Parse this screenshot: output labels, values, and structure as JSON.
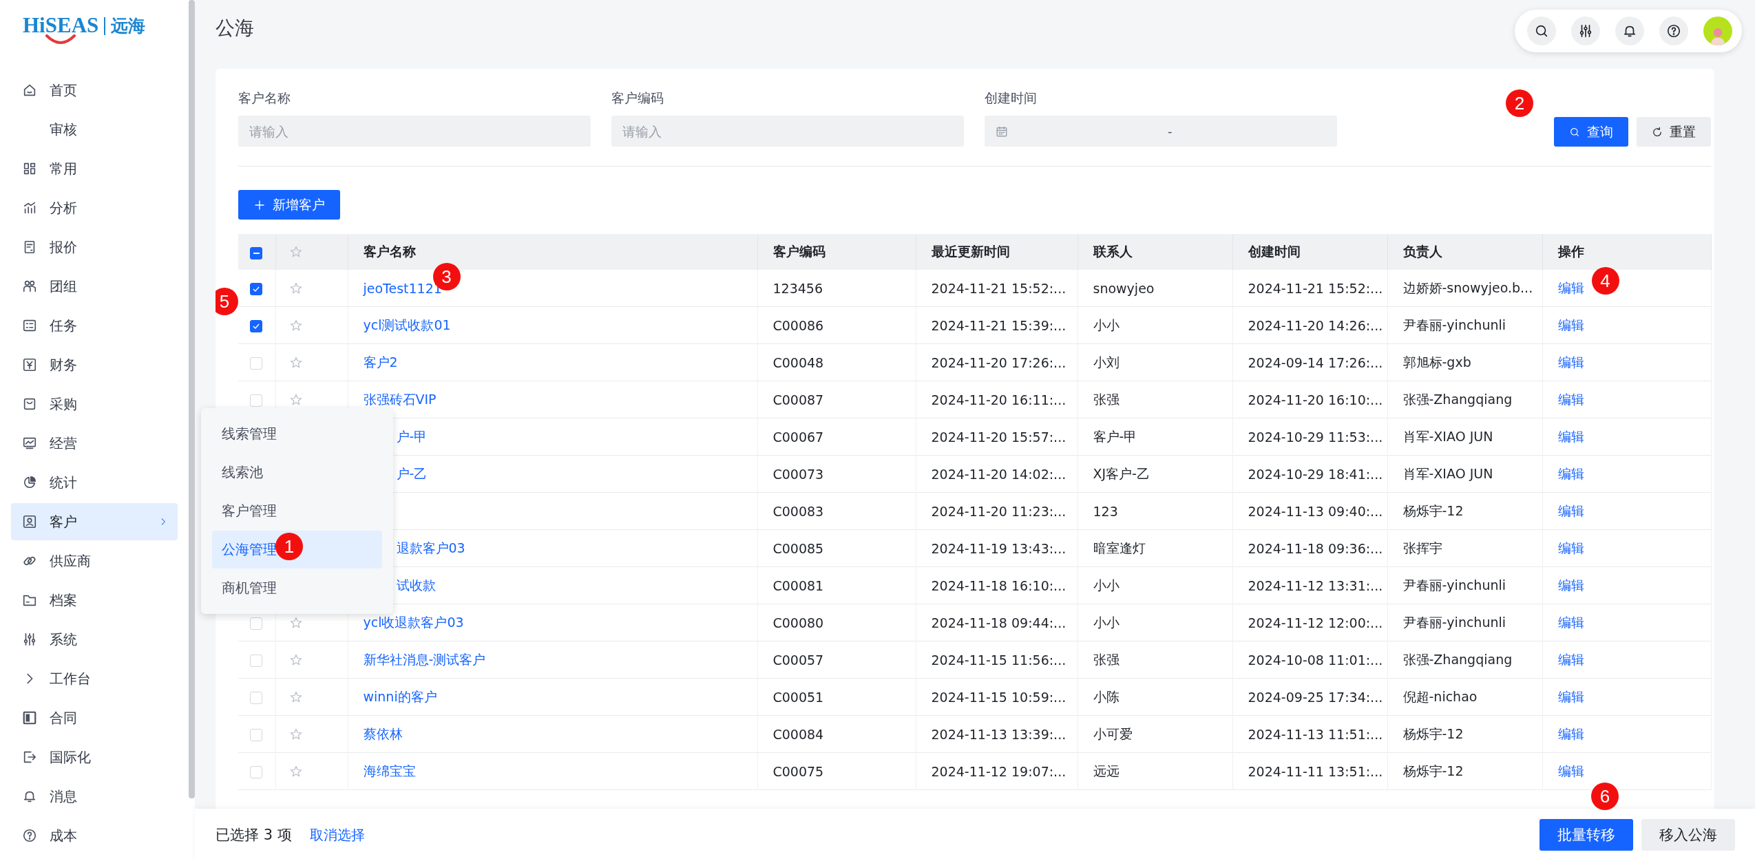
{
  "sidebar": {
    "logo": {
      "brand": "HiSEAS",
      "suffix": "远海"
    },
    "items": [
      {
        "label": "首页",
        "selected": false
      },
      {
        "label": "审核",
        "selected": false
      },
      {
        "label": "常用",
        "selected": false
      },
      {
        "label": "分析",
        "selected": false
      },
      {
        "label": "报价",
        "selected": false
      },
      {
        "label": "团组",
        "selected": false
      },
      {
        "label": "任务",
        "selected": false
      },
      {
        "label": "财务",
        "selected": false
      },
      {
        "label": "采购",
        "selected": false
      },
      {
        "label": "经营",
        "selected": false
      },
      {
        "label": "统计",
        "selected": false
      },
      {
        "label": "客户",
        "selected": true
      },
      {
        "label": "供应商",
        "selected": false
      },
      {
        "label": "档案",
        "selected": false
      },
      {
        "label": "系统",
        "selected": false
      },
      {
        "label": "工作台",
        "selected": false
      },
      {
        "label": "合同",
        "selected": false
      },
      {
        "label": "国际化",
        "selected": false
      },
      {
        "label": "消息",
        "selected": false
      },
      {
        "label": "成本",
        "selected": false
      }
    ]
  },
  "page_title": "公海",
  "filters": [
    {
      "kind": "text",
      "label": "客户名称",
      "placeholder": "请输入"
    },
    {
      "kind": "text",
      "label": "客户编码",
      "placeholder": "请输入"
    },
    {
      "kind": "daterange",
      "label": "创建时间",
      "separator": "-"
    }
  ],
  "filter_buttons": [
    {
      "kind": "primary",
      "label": "查询",
      "annotation": "2"
    },
    {
      "kind": "default",
      "label": "重置"
    }
  ],
  "add_button": {
    "label": "新增客户"
  },
  "table": {
    "columns": [
      "客户名称",
      "客户编码",
      "最近更新时间",
      "联系人",
      "创建时间",
      "负责人",
      "操作"
    ],
    "header_checkbox": {
      "indeterminate": true
    },
    "rows": [
      {
        "covered": false,
        "checked": true,
        "name": "jeoTest1121",
        "code": "123456",
        "updated": "2024-11-21 15:52:...",
        "contact": "snowyjeo",
        "created": "2024-11-21 15:52:...",
        "owner": "边娇娇-snowyjeo.b...",
        "action": "编辑",
        "annotation_check": "5",
        "annotation_name": "3",
        "annotation_action": "4"
      },
      {
        "covered": false,
        "checked": true,
        "name": "ycl测试收款01",
        "code": "C00086",
        "updated": "2024-11-21 15:39:...",
        "contact": "小小",
        "created": "2024-11-20 14:26:...",
        "owner": "尹春丽-yinchunli",
        "action": "编辑"
      },
      {
        "covered": false,
        "checked": false,
        "name": "客户2",
        "code": "C00048",
        "updated": "2024-11-20 17:26:...",
        "contact": "小刘",
        "created": "2024-09-14 17:26:...",
        "owner": "郭旭标-gxb",
        "action": "编辑"
      },
      {
        "covered": false,
        "checked": false,
        "name": "张强砖石VIP",
        "code": "C00087",
        "updated": "2024-11-20 16:11:...",
        "contact": "张强",
        "created": "2024-11-20 16:10:...",
        "owner": "张强-Zhangqiang",
        "action": "编辑"
      },
      {
        "covered": true,
        "name": "户-甲",
        "code": "C00067",
        "updated": "2024-11-20 15:57:...",
        "contact": "客户-甲",
        "created": "2024-10-29 11:53:...",
        "owner": "肖军-XIAO JUN",
        "action": "编辑"
      },
      {
        "covered": true,
        "name": "户-乙",
        "code": "C00073",
        "updated": "2024-11-20 14:02:...",
        "contact": "XJ客户-乙",
        "created": "2024-10-29 18:41:...",
        "owner": "肖军-XIAO JUN",
        "action": "编辑"
      },
      {
        "code": "C00083",
        "updated": "2024-11-20 11:23:...",
        "contact": "123",
        "created": "2024-11-13 09:40:...",
        "owner": "杨烁宇-12",
        "action": "编辑"
      },
      {
        "covered": true,
        "name": "退款客户03",
        "code": "C00085",
        "updated": "2024-11-19 13:43:...",
        "contact": "暗室逢灯",
        "created": "2024-11-18 09:36:...",
        "owner": "张挥宇",
        "action": "编辑"
      },
      {
        "covered": true,
        "name": "试收款",
        "code": "C00081",
        "updated": "2024-11-18 16:10:...",
        "contact": "小小",
        "created": "2024-11-12 13:31:...",
        "owner": "尹春丽-yinchunli",
        "action": "编辑"
      },
      {
        "covered": false,
        "checked": false,
        "name": "ycl收退款客户03",
        "code": "C00080",
        "updated": "2024-11-18 09:44:...",
        "contact": "小小",
        "created": "2024-11-12 12:00:...",
        "owner": "尹春丽-yinchunli",
        "action": "编辑"
      },
      {
        "covered": false,
        "checked": false,
        "name": "新华社消息-测试客户",
        "code": "C00057",
        "updated": "2024-11-15 11:56:...",
        "contact": "张强",
        "created": "2024-10-08 11:01:...",
        "owner": "张强-Zhangqiang",
        "action": "编辑"
      },
      {
        "covered": false,
        "checked": false,
        "name": "winni的客户",
        "code": "C00051",
        "updated": "2024-11-15 10:59:...",
        "contact": "小陈",
        "created": "2024-09-25 17:34:...",
        "owner": "倪超-nichao",
        "action": "编辑"
      },
      {
        "covered": false,
        "checked": false,
        "name": "蔡依林",
        "code": "C00084",
        "updated": "2024-11-13 13:39:...",
        "contact": "小可爱",
        "created": "2024-11-13 11:51:...",
        "owner": "杨烁宇-12",
        "action": "编辑"
      },
      {
        "covered": false,
        "checked": false,
        "name": "海绵宝宝",
        "code": "C00075",
        "updated": "2024-11-12 19:07:...",
        "contact": "远远",
        "created": "2024-11-11 13:51:...",
        "owner": "杨烁宇-12",
        "action": "编辑"
      }
    ]
  },
  "submenu": {
    "items": [
      {
        "label": "线索管理",
        "selected": false
      },
      {
        "label": "线索池",
        "selected": false
      },
      {
        "label": "客户管理",
        "selected": false
      },
      {
        "label": "公海管理",
        "selected": true,
        "annotation": "1"
      },
      {
        "label": "商机管理",
        "selected": false
      }
    ]
  },
  "footer": {
    "selection": "已选择 3 项",
    "clear_link": "取消选择",
    "buttons": [
      {
        "kind": "primary",
        "label": "批量转移",
        "annotation": "6"
      },
      {
        "kind": "default",
        "label": "移入公海"
      }
    ]
  }
}
